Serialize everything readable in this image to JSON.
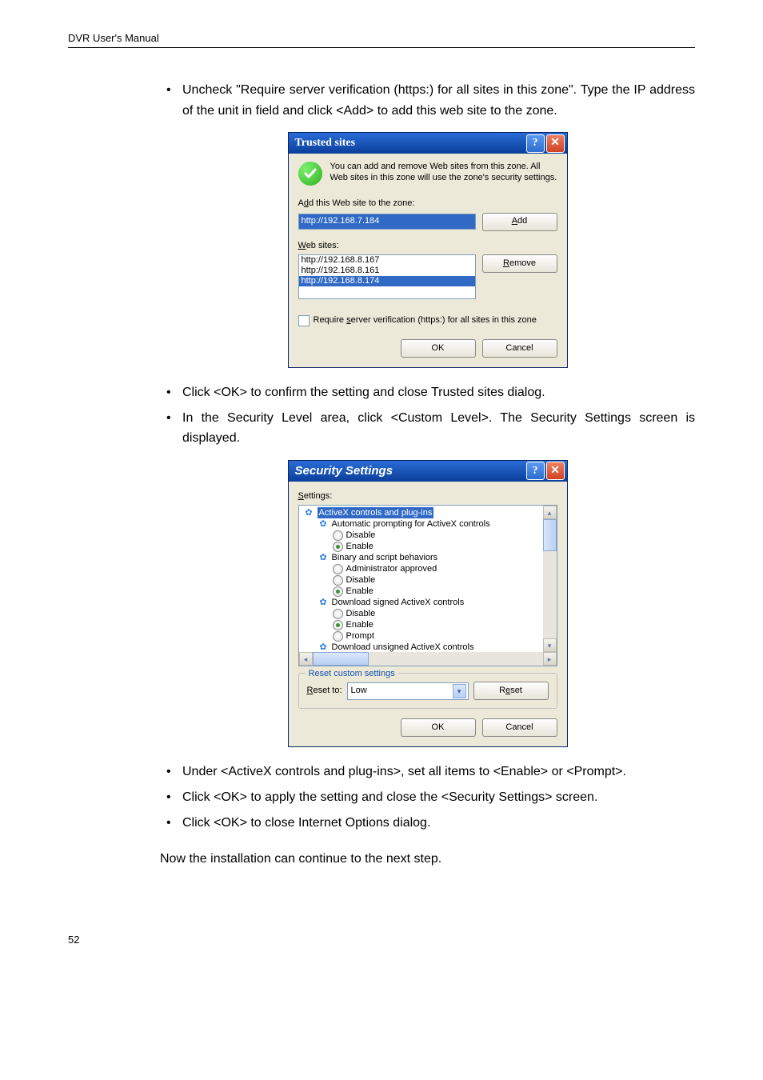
{
  "header": "DVR User's Manual",
  "page_number": "52",
  "bullets1": [
    "Uncheck \"Require server verification (https:) for all sites in this zone\". Type the IP address of the unit in field and click <Add> to add this web site to the zone."
  ],
  "bullets2": [
    "Click <OK> to confirm the setting and close Trusted sites dialog.",
    "In the Security Level area, click <Custom Level>. The Security Settings screen is displayed."
  ],
  "bullets3": [
    "Under <ActiveX controls and plug-ins>, set all items to <Enable> or <Prompt>.",
    "Click <OK> to apply the setting and close the <Security Settings> screen.",
    "Click <OK> to close Internet Options dialog."
  ],
  "closing": "Now the installation can continue to the next step.",
  "trusted": {
    "title": "Trusted sites",
    "desc": "You can add and remove Web sites from this zone. All Web sites in this zone will use the zone's security settings.",
    "add_label_pre": "A",
    "add_label_u": "d",
    "add_label_post": "d this Web site to the zone:",
    "input_value": "http://192.168.7.184",
    "add_btn_pre": "",
    "add_btn_u": "A",
    "add_btn_post": "dd",
    "websites_label_u": "W",
    "websites_label_post": "eb sites:",
    "sites": [
      "http://192.168.8.167",
      "http://192.168.8.161",
      "http://192.168.8.174"
    ],
    "remove_btn_pre": "",
    "remove_btn_u": "R",
    "remove_btn_post": "emove",
    "chk_pre": "Require ",
    "chk_u": "s",
    "chk_post": "erver verification (https:) for all sites in this zone",
    "ok": "OK",
    "cancel": "Cancel"
  },
  "sec": {
    "title": "Security Settings",
    "settings_u": "S",
    "settings_post": "ettings:",
    "cat": "ActiveX controls and plug-ins",
    "i1": "Automatic prompting for ActiveX controls",
    "i2": "Binary and script behaviors",
    "i3": "Download signed ActiveX controls",
    "i4": "Download unsigned ActiveX controls",
    "opt_disable": "Disable",
    "opt_enable": "Enable",
    "opt_admin": "Administrator approved",
    "opt_prompt": "Prompt",
    "legend": "Reset custom settings",
    "reset_to_u": "R",
    "reset_to_post": "eset to:",
    "combo_val": "Low",
    "reset_btn_pre": "R",
    "reset_btn_u": "e",
    "reset_btn_post": "set",
    "ok": "OK",
    "cancel": "Cancel"
  }
}
